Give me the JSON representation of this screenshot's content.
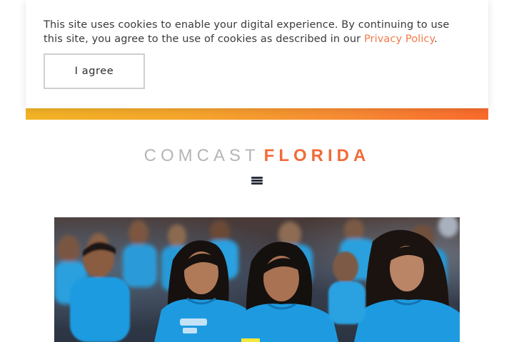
{
  "cookie_banner": {
    "text": "This site uses cookies to enable your digital experience. By continuing to use this site, you agree to the use of cookies as described in our ",
    "link_text": "Privacy Policy",
    "text_end": ".",
    "button_label": "I agree"
  },
  "header": {
    "brand_main": "COMCAST",
    "brand_region": "FLORIDA",
    "menu_icon": "hamburger-menu-icon"
  },
  "hero": {
    "image_subject": "children in blue t-shirts seated in an audience"
  },
  "colors": {
    "accent": "#f26b3a",
    "link": "#f07a4a",
    "gradient_start": "#f2b325",
    "gradient_end": "#f86a2c",
    "shirt_blue": "#1e9be0"
  }
}
